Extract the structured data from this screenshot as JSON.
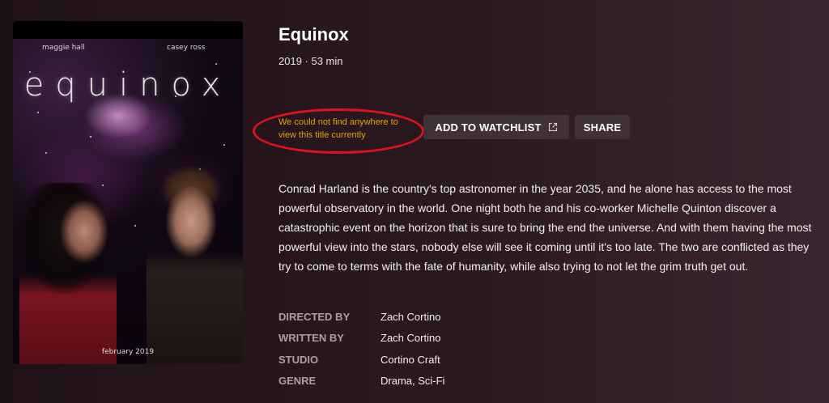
{
  "poster": {
    "credit_left": "maggie hall",
    "credit_right": "casey ross",
    "title_text": "equinox",
    "date_text": "february 2019"
  },
  "title": "Equinox",
  "meta": "2019 · 53 min",
  "availability": {
    "message": "We could not find anywhere to view this title currently",
    "highlight_color": "#e0121e",
    "text_color": "#e5a00d"
  },
  "actions": {
    "watchlist_label": "ADD TO WATCHLIST",
    "watchlist_icon": "external-link-icon",
    "share_label": "SHARE"
  },
  "description": "Conrad Harland is the country's top astronomer in the year 2035, and he alone has access to the most powerful observatory in the world. One night both he and his co-worker Michelle Quinton discover a catastrophic event on the horizon that is sure to bring the end the universe. And with them having the most powerful view into the stars, nobody else will see it coming until it's too late. The two are conflicted as they try to come to terms with the fate of humanity, while also trying to not let the grim truth get out.",
  "credits": [
    {
      "label": "DIRECTED BY",
      "value": "Zach Cortino"
    },
    {
      "label": "WRITTEN BY",
      "value": "Zach Cortino"
    },
    {
      "label": "STUDIO",
      "value": "Cortino Craft"
    },
    {
      "label": "GENRE",
      "value": "Drama, Sci-Fi"
    }
  ]
}
